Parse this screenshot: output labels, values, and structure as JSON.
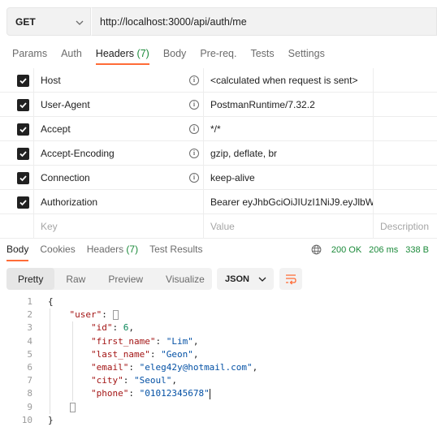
{
  "request": {
    "method": "GET",
    "url": "http://localhost:3000/api/auth/me",
    "tabs": [
      {
        "label": "Params"
      },
      {
        "label": "Auth"
      },
      {
        "label": "Headers",
        "count": "(7)"
      },
      {
        "label": "Body"
      },
      {
        "label": "Pre-req."
      },
      {
        "label": "Tests"
      },
      {
        "label": "Settings"
      }
    ],
    "active_tab": "Headers"
  },
  "headers": {
    "rows": [
      {
        "checked": true,
        "key": "Host",
        "value": "<calculated when request is sent>",
        "info": true
      },
      {
        "checked": true,
        "key": "User-Agent",
        "value": "PostmanRuntime/7.32.2",
        "info": true
      },
      {
        "checked": true,
        "key": "Accept",
        "value": "*/*",
        "info": true
      },
      {
        "checked": true,
        "key": "Accept-Encoding",
        "value": "gzip, deflate, br",
        "info": true
      },
      {
        "checked": true,
        "key": "Connection",
        "value": "keep-alive",
        "info": true
      },
      {
        "checked": true,
        "key": "Authorization",
        "value": "Bearer eyJhbGciOiJIUzI1NiJ9.eyJlbW...",
        "info": false
      }
    ],
    "placeholder": {
      "key": "Key",
      "value": "Value",
      "description": "Description"
    }
  },
  "response": {
    "tabs": [
      {
        "label": "Body"
      },
      {
        "label": "Cookies"
      },
      {
        "label": "Headers",
        "count": "(7)"
      },
      {
        "label": "Test Results"
      }
    ],
    "active_tab": "Body",
    "status": "200 OK",
    "time": "206 ms",
    "size": "338 B",
    "views": [
      "Pretty",
      "Raw",
      "Preview",
      "Visualize"
    ],
    "active_view": "Pretty",
    "format": "JSON"
  },
  "code_lines": [
    {
      "n": "1"
    },
    {
      "n": "2"
    },
    {
      "n": "3"
    },
    {
      "n": "4"
    },
    {
      "n": "5"
    },
    {
      "n": "6"
    },
    {
      "n": "7"
    },
    {
      "n": "8"
    },
    {
      "n": "9"
    },
    {
      "n": "10"
    }
  ],
  "body": {
    "user_key": "\"user\"",
    "fields": [
      {
        "key": "\"id\"",
        "value": "6",
        "type": "number"
      },
      {
        "key": "\"first_name\"",
        "value": "\"Lim\"",
        "type": "string"
      },
      {
        "key": "\"last_name\"",
        "value": "\"Geon\"",
        "type": "string"
      },
      {
        "key": "\"email\"",
        "value": "\"eleg42y@hotmail.com\"",
        "type": "string"
      },
      {
        "key": "\"city\"",
        "value": "\"Seoul\"",
        "type": "string"
      },
      {
        "key": "\"phone\"",
        "value": "\"01012345678\"",
        "type": "string"
      }
    ]
  },
  "colors": {
    "accent": "#ff6c37",
    "status_green": "#1b8a3a",
    "json_key": "#a31515",
    "json_string": "#0451a5",
    "json_number": "#098658"
  }
}
